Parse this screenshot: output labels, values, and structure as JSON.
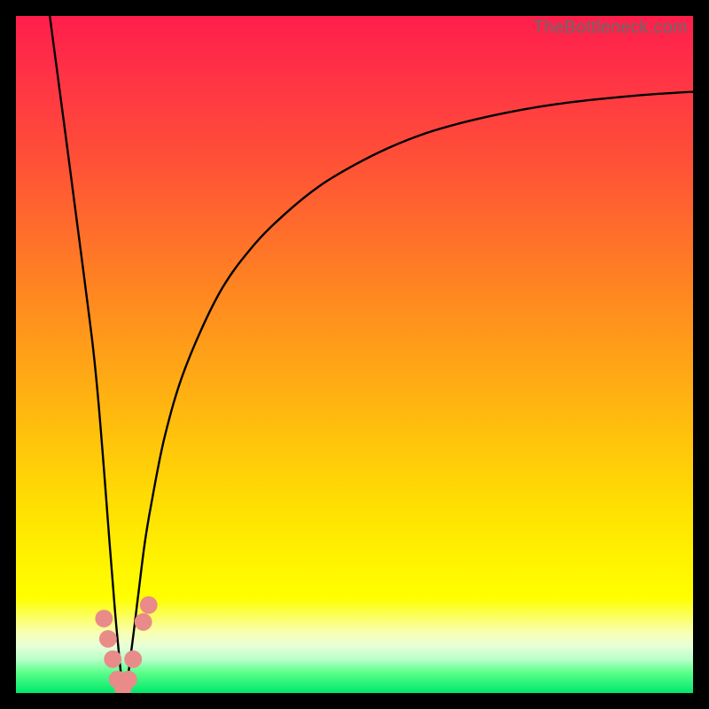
{
  "watermark": {
    "text": "TheBottleneck.com"
  },
  "chart_data": {
    "type": "line",
    "title": "",
    "xlabel": "",
    "ylabel": "",
    "xlim": [
      0,
      100
    ],
    "ylim": [
      0,
      100
    ],
    "grid": false,
    "legend": false,
    "series": [
      {
        "name": "curve",
        "x": [
          5,
          10,
          12,
          14,
          15,
          16,
          17,
          18,
          19,
          20,
          22,
          25,
          30,
          35,
          40,
          45,
          50,
          55,
          60,
          65,
          70,
          75,
          80,
          85,
          90,
          95,
          100
        ],
        "values": [
          100,
          62,
          45,
          20,
          8,
          0,
          6,
          14,
          22,
          28,
          38,
          48,
          59,
          66,
          71,
          75,
          78,
          80.5,
          82.5,
          84,
          85.2,
          86.2,
          87,
          87.6,
          88.1,
          88.5,
          88.8
        ]
      }
    ],
    "markers": {
      "name": "highlight-points",
      "color": "#e98b89",
      "radius_pct": 1.3,
      "points": [
        {
          "x": 13.0,
          "y": 11.0
        },
        {
          "x": 13.6,
          "y": 8.0
        },
        {
          "x": 14.3,
          "y": 5.0
        },
        {
          "x": 15.0,
          "y": 2.0
        },
        {
          "x": 15.8,
          "y": 0.8
        },
        {
          "x": 16.6,
          "y": 2.0
        },
        {
          "x": 17.3,
          "y": 5.0
        },
        {
          "x": 18.8,
          "y": 10.5
        },
        {
          "x": 19.6,
          "y": 13.0
        }
      ]
    }
  }
}
